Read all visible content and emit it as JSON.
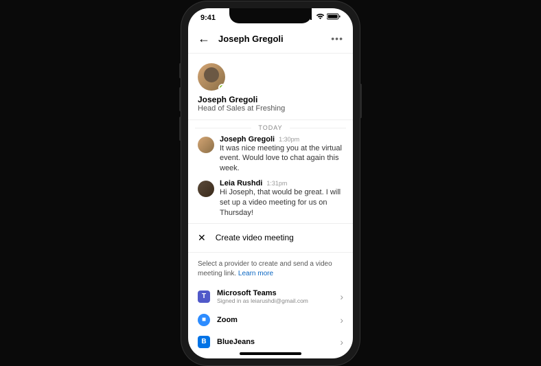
{
  "status": {
    "time": "9:41"
  },
  "header": {
    "title": "Joseph Gregoli"
  },
  "profile": {
    "name": "Joseph Gregoli",
    "title": "Head of Sales at Freshing"
  },
  "date_divider": "TODAY",
  "messages": [
    {
      "name": "Joseph Gregoli",
      "time": "1:30pm",
      "text": "It was nice meeting you at the virtual event. Would love to chat again this week."
    },
    {
      "name": "Leia Rushdi",
      "time": "1:31pm",
      "text": "Hi Joseph, that would be great. I will set up a video meeting for us on Thursday!"
    }
  ],
  "sheet": {
    "title": "Create video meeting",
    "description": "Select a provider to create and send a video meeting link.",
    "learn_more": "Learn more"
  },
  "providers": [
    {
      "name": "Microsoft Teams",
      "sub": "Signed in as leiarushdi@gmail.com",
      "glyph": "T"
    },
    {
      "name": "Zoom",
      "sub": "",
      "glyph": "■"
    },
    {
      "name": "BlueJeans",
      "sub": "",
      "glyph": "B"
    }
  ]
}
